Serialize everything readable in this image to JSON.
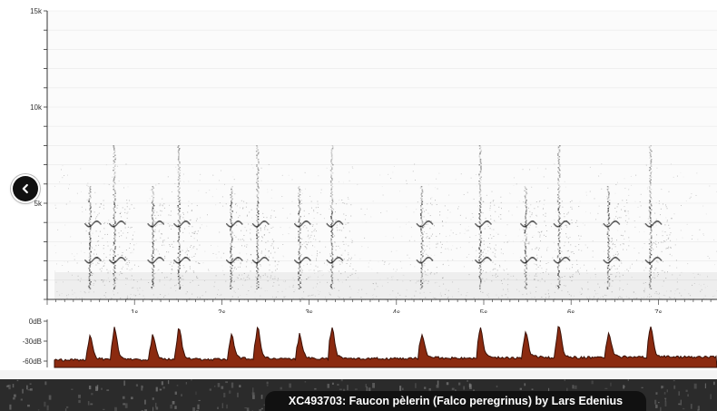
{
  "spectrogram": {
    "y_ticks": [
      {
        "label": "15k",
        "khz": 15
      },
      {
        "label": "10k",
        "khz": 10
      },
      {
        "label": "5k",
        "khz": 5
      }
    ],
    "y_max_khz": 15,
    "x_ticks": [
      {
        "label": "1s",
        "sec": 1
      },
      {
        "label": "2s",
        "sec": 2
      },
      {
        "label": "3s",
        "sec": 3
      },
      {
        "label": "4s",
        "sec": 4
      },
      {
        "label": "5s",
        "sec": 5
      },
      {
        "label": "6s",
        "sec": 6
      },
      {
        "label": "7s",
        "sec": 7
      }
    ],
    "calls_sec": [
      0.48,
      0.76,
      1.2,
      1.5,
      2.1,
      2.4,
      2.88,
      3.25,
      4.28,
      4.95,
      5.47,
      5.85,
      6.42,
      6.9
    ]
  },
  "waveform": {
    "db_ticks": [
      {
        "label": "0dB",
        "db": 0
      },
      {
        "label": "-30dB",
        "db": -30
      },
      {
        "label": "-60dB",
        "db": -60
      }
    ],
    "fill_color": "#8b2a10",
    "edge_color": "#3a1006"
  },
  "nav": {
    "prev_icon": "chevron-left-icon"
  },
  "caption": {
    "text": "XC493703: Faucon pèlerin (Falco peregrinus) by Lars Edenius"
  }
}
